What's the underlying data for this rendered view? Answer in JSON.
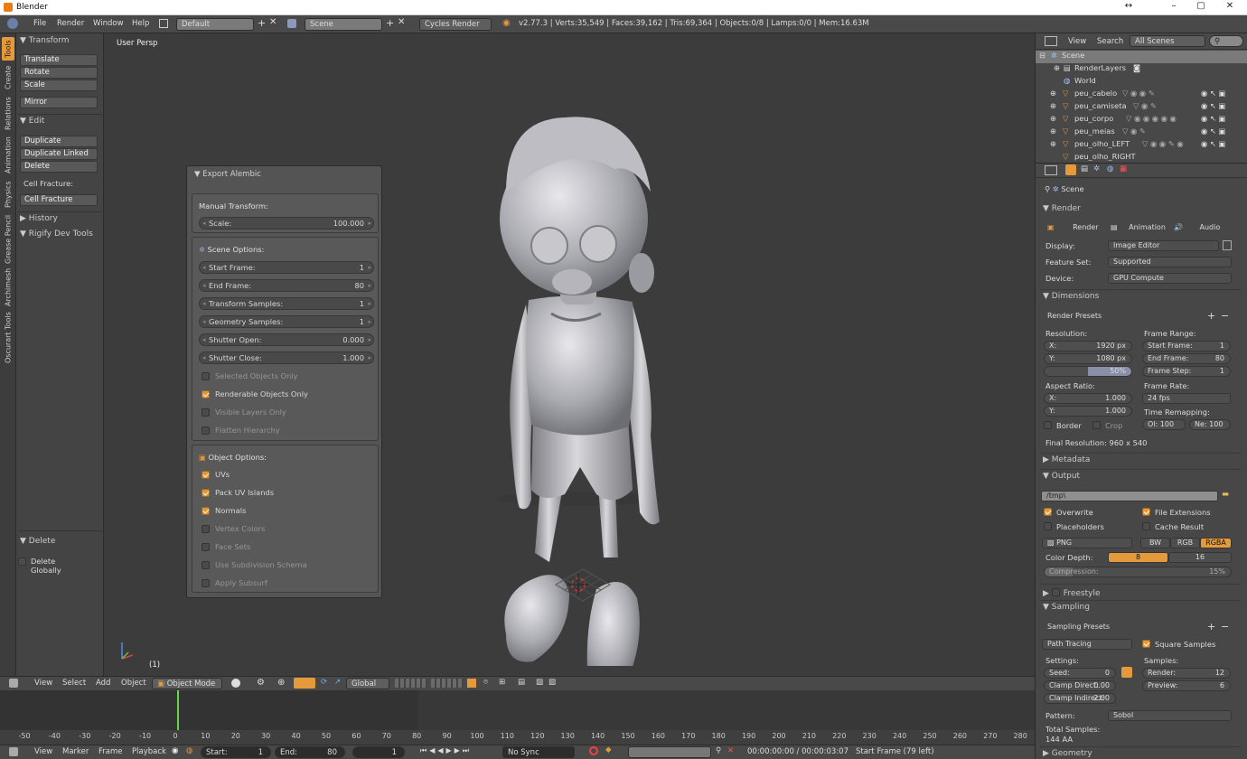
{
  "window": {
    "title": "Blender",
    "minimize": "–",
    "maximize": "▢",
    "close": "✕",
    "resize": "↔"
  },
  "info": {
    "menus": [
      "File",
      "Render",
      "Window",
      "Help"
    ],
    "layout": "Default",
    "scene": "Scene",
    "engine": "Cycles Render",
    "stats": "v2.77.3 | Verts:35,549 | Faces:39,162 | Tris:69,364 | Objects:0/8 | Lamps:0/0 | Mem:16.63M"
  },
  "tool_tabs": [
    "Tools",
    "Create",
    "Relations",
    "Animation",
    "Physics",
    "Grease Pencil",
    "Archimesh",
    "Oscurart Tools"
  ],
  "toolshelf": {
    "transform": "Transform",
    "translate": "Translate",
    "rotate": "Rotate",
    "scale": "Scale",
    "mirror": "Mirror",
    "edit": "Edit",
    "duplicate": "Duplicate",
    "duplicate_linked": "Duplicate Linked",
    "delete": "Delete",
    "cell_fracture_label": "Cell Fracture:",
    "cell_fracture": "Cell Fracture",
    "history": "History",
    "rigify": "Rigify Dev Tools",
    "delete_panel": "Delete",
    "delete_globally": "Delete Globally"
  },
  "viewport": {
    "label": "User Persp",
    "frame": "(1)"
  },
  "alembic": {
    "title": "Export Alembic",
    "manual": "Manual Transform:",
    "scale_label": "Scale:",
    "scale": "100.000",
    "scene_options": "Scene Options:",
    "start_label": "Start Frame:",
    "start": "1",
    "end_label": "End Frame:",
    "end": "80",
    "tsamp_label": "Transform Samples:",
    "tsamp": "1",
    "gsamp_label": "Geometry Samples:",
    "gsamp": "1",
    "sopen_label": "Shutter Open:",
    "sopen": "0.000",
    "sclose_label": "Shutter Close:",
    "sclose": "1.000",
    "selected_only": "Selected Objects Only",
    "renderable_only": "Renderable Objects Only",
    "visible_layers": "Visible Layers Only",
    "flatten": "Flatten Hierarchy",
    "object_options": "Object Options:",
    "uvs": "UVs",
    "pack_uv": "Pack UV Islands",
    "normals": "Normals",
    "vcolors": "Vertex Colors",
    "face_sets": "Face Sets",
    "subdiv": "Use Subdivision Schema",
    "apply_subsurf": "Apply Subsurf"
  },
  "vp_header": {
    "view": "View",
    "select": "Select",
    "add": "Add",
    "object": "Object",
    "mode": "Object Mode",
    "orientation": "Global"
  },
  "timeline": {
    "ticks": [
      "-50",
      "-40",
      "-30",
      "-20",
      "-10",
      "0",
      "10",
      "20",
      "30",
      "40",
      "50",
      "60",
      "70",
      "80",
      "90",
      "100",
      "110",
      "120",
      "130",
      "140",
      "150",
      "160",
      "170",
      "180",
      "190",
      "200",
      "210",
      "220",
      "230",
      "240",
      "250",
      "260",
      "270",
      "280"
    ],
    "current": "0"
  },
  "tl_footer": {
    "view": "View",
    "marker": "Marker",
    "frame": "Frame",
    "playback": "Playback",
    "start_label": "Start:",
    "start": "1",
    "end_label": "End:",
    "end": "80",
    "current": "1",
    "sync": "No Sync",
    "time": "00:00:00:00 / 00:00:03:07",
    "status": "Start Frame (79 left)"
  },
  "outliner": {
    "view": "View",
    "search": "Search",
    "filter": "All Scenes",
    "rows": [
      "Scene",
      "RenderLayers",
      "World",
      "peu_cabelo",
      "peu_camiseta",
      "peu_corpo",
      "peu_meias",
      "peu_olho_LEFT",
      "peu_olho_RIGHT"
    ]
  },
  "props": {
    "context": "Scene",
    "render": "Render",
    "tab_render": "Render",
    "tab_anim": "Animation",
    "tab_audio": "Audio",
    "display_label": "Display:",
    "display": "Image Editor",
    "feature_label": "Feature Set:",
    "feature": "Supported",
    "device_label": "Device:",
    "device": "GPU Compute",
    "dimensions": "Dimensions",
    "presets": "Render Presets",
    "resolution": "Resolution:",
    "res_x_label": "X:",
    "res_x": "1920 px",
    "res_y_label": "Y:",
    "res_y": "1080 px",
    "res_pct": "50%",
    "frame_range": "Frame Range:",
    "start_label": "Start Frame:",
    "start": "1",
    "end_label": "End Frame:",
    "end": "80",
    "step_label": "Frame Step:",
    "step": "1",
    "aspect": "Aspect Ratio:",
    "asp_x_label": "X:",
    "asp_x": "1.000",
    "asp_y_label": "Y:",
    "asp_y": "1.000",
    "frame_rate": "Frame Rate:",
    "fps": "24 fps",
    "time_remap": "Time Remapping:",
    "old": "Ol: 100",
    "new": "Ne: 100",
    "border": "Border",
    "crop": "Crop",
    "final_res": "Final Resolution: 960 x 540",
    "metadata": "Metadata",
    "output": "Output",
    "path": "/tmp\\",
    "overwrite": "Overwrite",
    "file_ext": "File Extensions",
    "placeholders": "Placeholders",
    "cache": "Cache Result",
    "format": "PNG",
    "bw": "BW",
    "rgb": "RGB",
    "rgba": "RGBA",
    "depth_label": "Color Depth:",
    "d8": "8",
    "d16": "16",
    "compression": "Compression:",
    "compression_val": "15%",
    "freestyle": "Freestyle",
    "sampling": "Sampling",
    "sampling_presets": "Sampling Presets",
    "path_tracing": "Path Tracing",
    "square": "Square Samples",
    "settings": "Settings:",
    "samples": "Samples:",
    "seed_label": "Seed:",
    "seed": "0",
    "render_s_label": "Render:",
    "render_s": "12",
    "clamp_d_label": "Clamp Direct:",
    "clamp_d": "0.00",
    "preview_label": "Preview:",
    "preview": "6",
    "clamp_i_label": "Clamp Indirect:",
    "clamp_i": "2.00",
    "pattern_label": "Pattern:",
    "pattern": "Sobol",
    "total": "Total Samples:",
    "total_val": "144 AA",
    "geometry": "Geometry"
  }
}
